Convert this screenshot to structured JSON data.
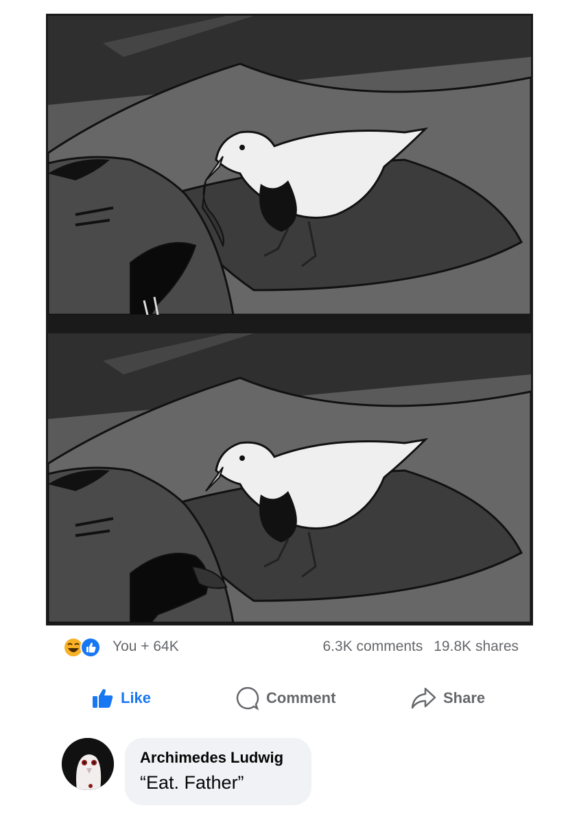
{
  "comic": {
    "panels": [
      {
        "scene": "pigeon-holding-mouse-over-sleeper"
      },
      {
        "scene": "pigeon-after-dropping-mouse"
      }
    ]
  },
  "post": {
    "reactions": {
      "icons": [
        "laughing-emoji-icon",
        "like-reaction-icon"
      ],
      "summary": "You + 64K"
    },
    "comments_count": "6.3K comments",
    "shares_count": "19.8K shares"
  },
  "actions": {
    "like_label": "Like",
    "comment_label": "Comment",
    "share_label": "Share"
  },
  "comment": {
    "author": "Archimedes Ludwig",
    "text": "“Eat. Father”"
  },
  "colors": {
    "brand_blue": "#1877f2",
    "muted_text": "#65676b",
    "bubble_bg": "#f0f2f5",
    "emoji_yellow": "#f7b125"
  }
}
